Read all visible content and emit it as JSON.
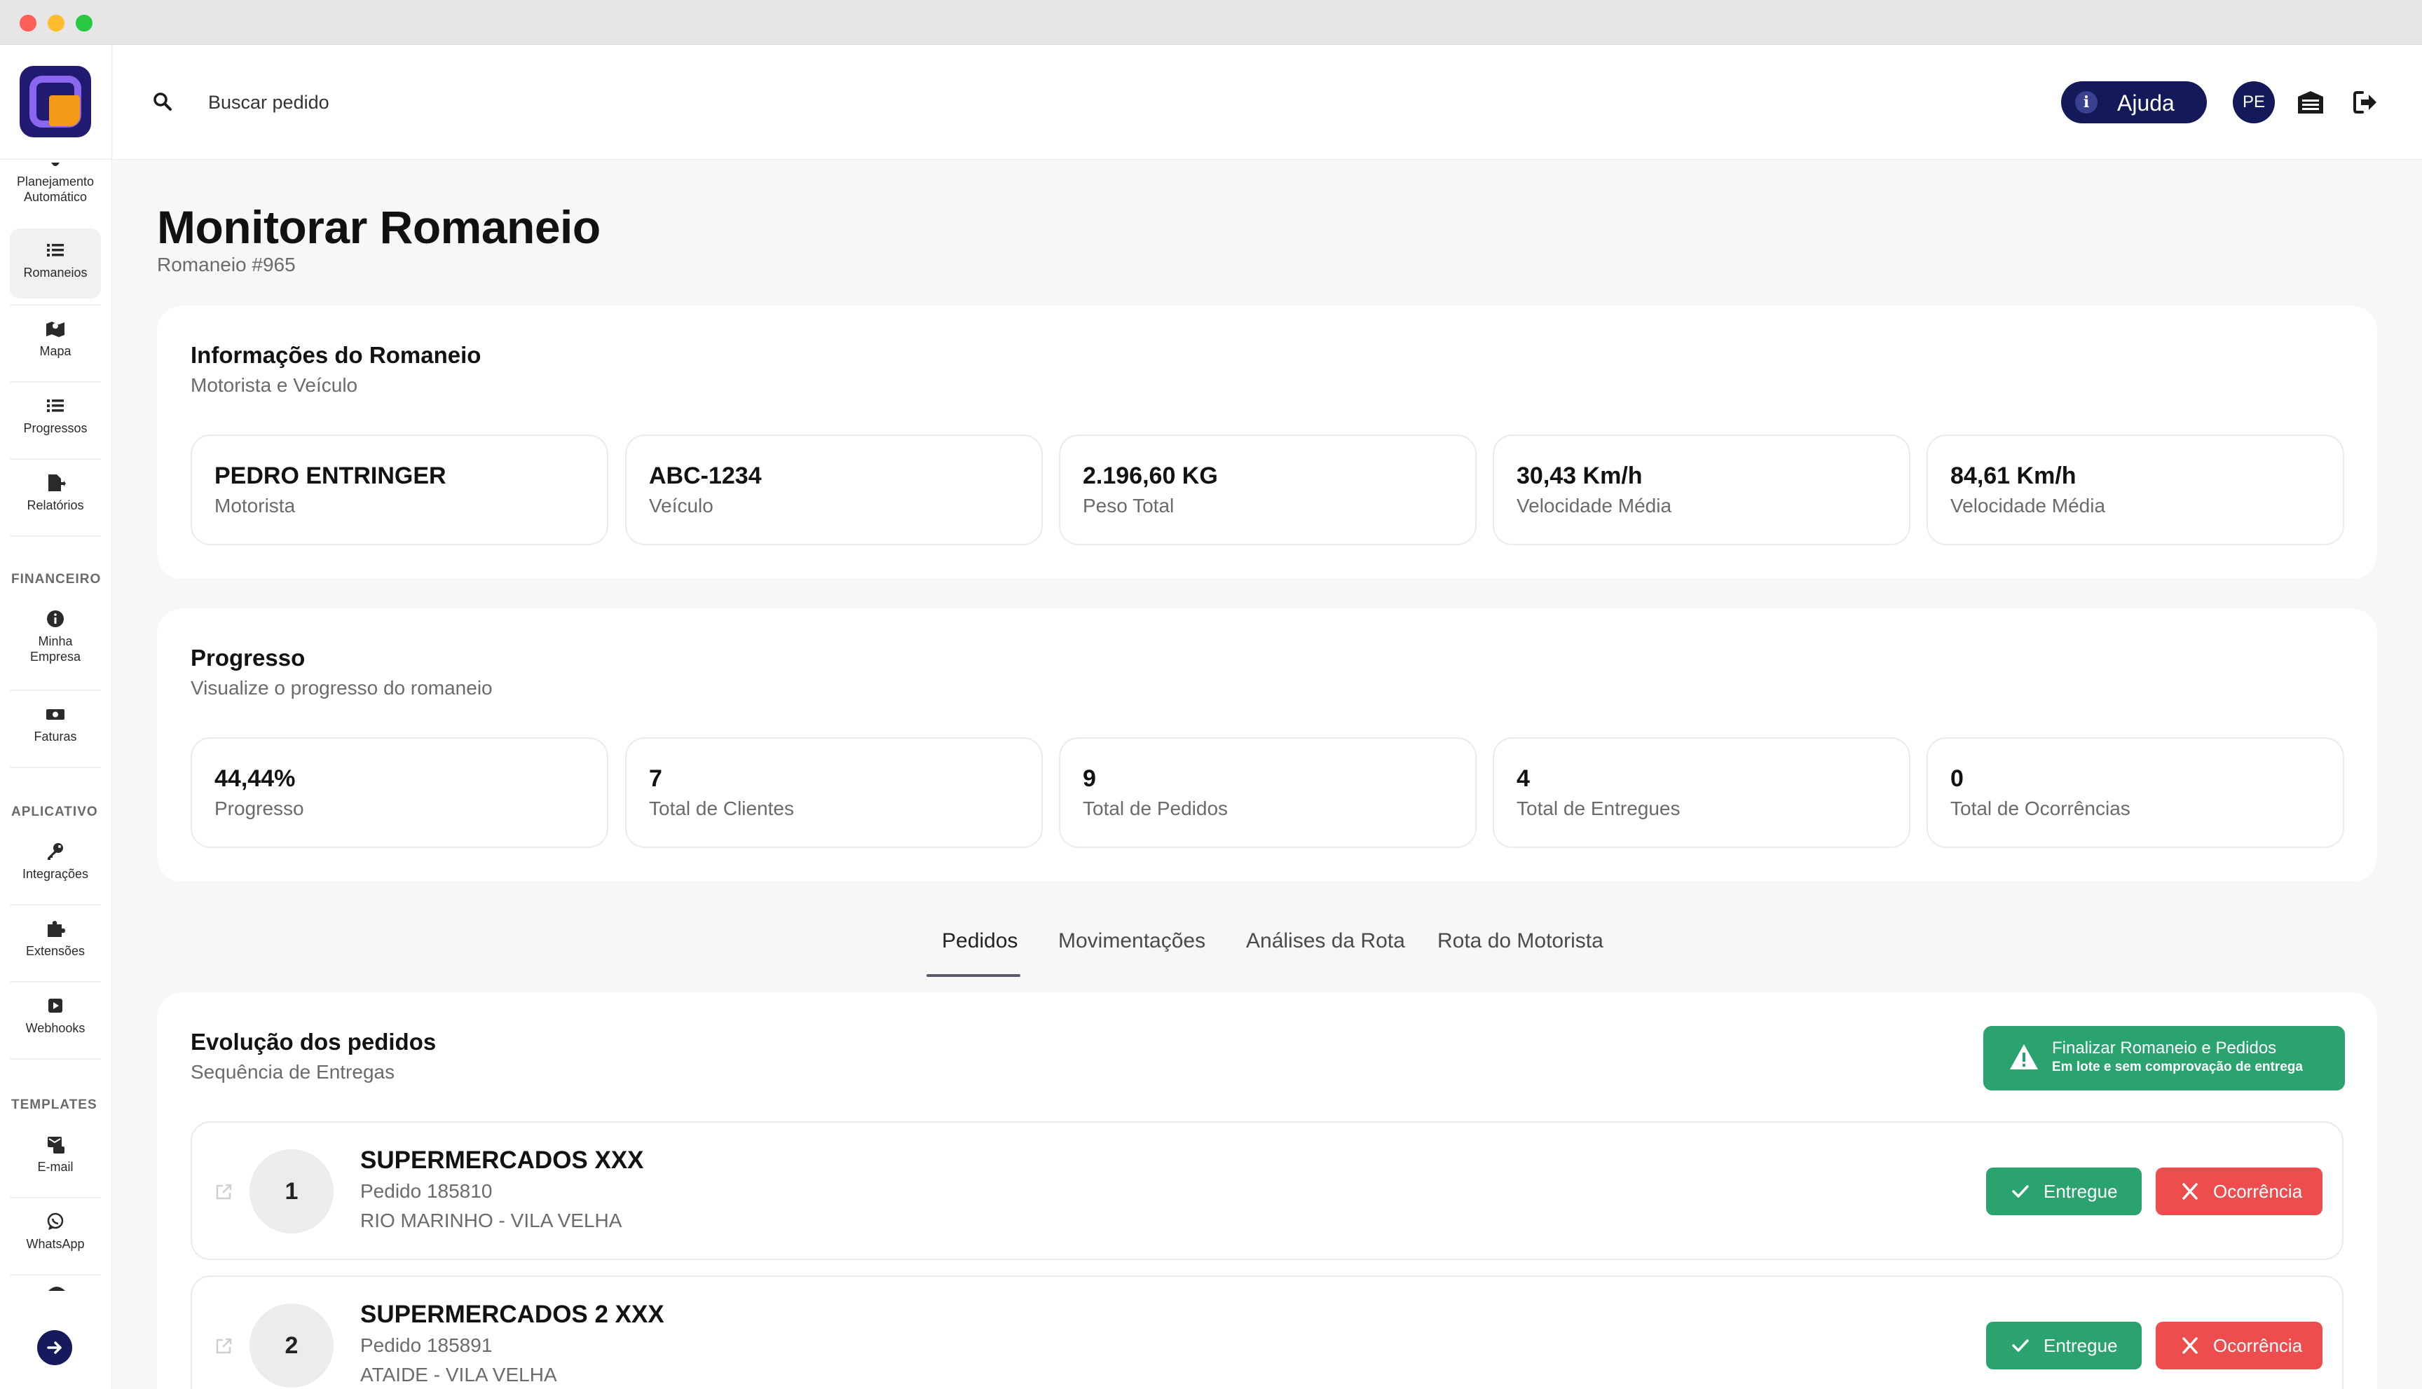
{
  "window": {
    "controls": [
      "close",
      "minimize",
      "maximize"
    ]
  },
  "sidebar": {
    "items": [
      {
        "label": "Planejamento Automático",
        "icon": "planning-icon"
      },
      {
        "label": "Romaneios",
        "icon": "list-icon",
        "active": true
      },
      {
        "label": "Mapa",
        "icon": "map-icon"
      },
      {
        "label": "Progressos",
        "icon": "list-icon"
      },
      {
        "label": "Relatórios",
        "icon": "report-icon"
      },
      {
        "label": "Minha Empresa",
        "icon": "info-icon"
      },
      {
        "label": "Faturas",
        "icon": "money-icon"
      },
      {
        "label": "Integrações",
        "icon": "key-icon"
      },
      {
        "label": "Extensões",
        "icon": "puzzle-icon"
      },
      {
        "label": "Webhooks",
        "icon": "webhook-icon"
      },
      {
        "label": "E-mail",
        "icon": "email-icon"
      },
      {
        "label": "WhatsApp",
        "icon": "whatsapp-icon"
      }
    ],
    "sections": {
      "financeiro": "FINANCEIRO",
      "aplicativo": "APLICATIVO",
      "templates": "TEMPLATES"
    },
    "accent": "#161a5c"
  },
  "header": {
    "search_placeholder": "Buscar pedido",
    "help_label": "Ajuda",
    "avatar_initials": "PE"
  },
  "page": {
    "title": "Monitorar Romaneio",
    "subtitle": "Romaneio #965"
  },
  "info": {
    "title": "Informações do Romaneio",
    "subtitle": "Motorista e Veículo",
    "stats": [
      {
        "value": "PEDRO ENTRINGER",
        "label": "Motorista"
      },
      {
        "value": "ABC-1234",
        "label": "Veículo"
      },
      {
        "value": "2.196,60 KG",
        "label": "Peso Total"
      },
      {
        "value": "30,43 Km/h",
        "label": "Velocidade Média"
      },
      {
        "value": "84,61 Km/h",
        "label": "Velocidade Média"
      }
    ]
  },
  "progress": {
    "title": "Progresso",
    "subtitle": "Visualize o progresso do romaneio",
    "stats": [
      {
        "value": "44,44%",
        "label": "Progresso"
      },
      {
        "value": "7",
        "label": "Total de Clientes"
      },
      {
        "value": "9",
        "label": "Total de Pedidos"
      },
      {
        "value": "4",
        "label": "Total de Entregues"
      },
      {
        "value": "0",
        "label": "Total de Ocorrências"
      }
    ]
  },
  "tabs": [
    "Pedidos",
    "Movimentações",
    "Análises da Rota",
    "Rota do Motorista"
  ],
  "orders": {
    "title": "Evolução dos pedidos",
    "subtitle": "Sequência de Entregas",
    "finalize_line1": "Finalizar Romaneio e Pedidos",
    "finalize_line2": "Em lote e sem comprovação de entrega",
    "delivered_label": "Entregue",
    "occurrence_label": "Ocorrência",
    "items": [
      {
        "seq": "1",
        "name": "SUPERMERCADOS XXX",
        "order": "Pedido 185810",
        "location": "RIO MARINHO - VILA VELHA"
      },
      {
        "seq": "2",
        "name": "SUPERMERCADOS 2 XXX",
        "order": "Pedido 185891",
        "location": "ATAIDE - VILA VELHA"
      }
    ]
  },
  "colors": {
    "success": "#2aa36f",
    "danger": "#ee4d4d",
    "brand": "#14195a"
  }
}
